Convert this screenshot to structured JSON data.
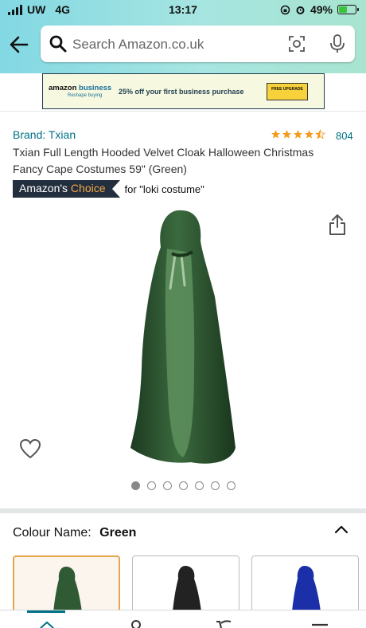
{
  "status_bar": {
    "carrier": "UW",
    "network": "4G",
    "time": "13:17",
    "battery": "49%"
  },
  "search": {
    "placeholder": "Search Amazon.co.uk"
  },
  "banner": {
    "brand_a": "amazon",
    "brand_b": "business",
    "tagline": "Reshape buying",
    "offer": "25% off your first business purchase",
    "button": "FREE UPGRADE"
  },
  "product": {
    "brand": "Brand: Txian",
    "rating": 4.5,
    "review_count": "804",
    "title": "Txian Full Length Hooded Velvet Cloak Halloween Christmas Fancy Cape Costumes 59\" (Green)",
    "choice_a": "Amazon's",
    "choice_b": "Choice",
    "choice_for": "for \"loki costume\"",
    "image_count": 7,
    "image_index": 1
  },
  "variation": {
    "label": "Colour Name:",
    "value": "Green",
    "swatches": [
      {
        "color": "#2f5a33",
        "selected": true
      },
      {
        "color": "#222222",
        "selected": false
      },
      {
        "color": "#1b2fa8",
        "selected": false
      }
    ]
  },
  "colors": {
    "link": "#007185",
    "star": "#f29c1f",
    "choice_badge": "#232f3e",
    "choice_accent": "#f3a847",
    "header_start": "#82d8e3",
    "header_end": "#a8e4cf"
  }
}
